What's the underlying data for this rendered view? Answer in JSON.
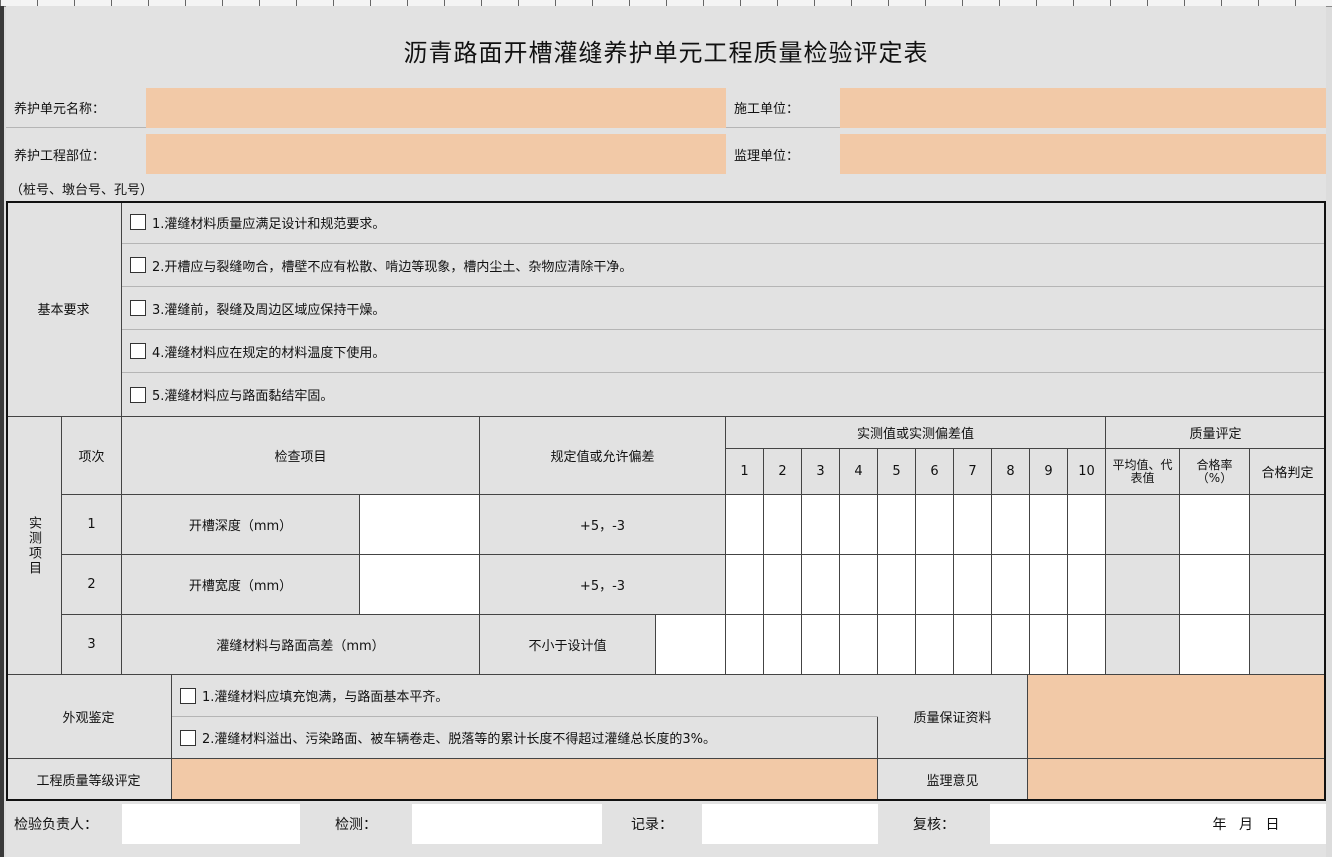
{
  "title": "沥青路面开槽灌缝养护单元工程质量检验评定表",
  "header": {
    "unit_name_label": "养护单元名称：",
    "unit_name_value": "",
    "contractor_label": "施工单位：",
    "contractor_value": "",
    "location_label": "养护工程部位：",
    "location_value": "",
    "supervisor_label": "监理单位：",
    "supervisor_value": "",
    "location_note": "（桩号、墩台号、孔号）"
  },
  "basic_requirements": {
    "label": "基本要求",
    "items": [
      "1.灌缝材料质量应满足设计和规范要求。",
      "2.开槽应与裂缝吻合，槽壁不应有松散、啃边等现象，槽内尘土、杂物应清除干净。",
      "3.灌缝前，裂缝及周边区域应保持干燥。",
      "4.灌缝材料应在规定的材料温度下使用。",
      "5.灌缝材料应与路面黏结牢固。"
    ]
  },
  "measured": {
    "section_label": "实测项目",
    "col_index": "项次",
    "col_item": "检查项目",
    "col_spec": "规定值或允许偏差",
    "col_values": "实测值或实测偏差值",
    "value_numbers": [
      "1",
      "2",
      "3",
      "4",
      "5",
      "6",
      "7",
      "8",
      "9",
      "10"
    ],
    "col_quality": "质量评定",
    "col_avg": "平均值、代表值",
    "col_rate": "合格率（%）",
    "col_judge": "合格判定",
    "rows": [
      {
        "index": "1",
        "item": "开槽深度（mm）",
        "spec": "+5，-3"
      },
      {
        "index": "2",
        "item": "开槽宽度（mm）",
        "spec": "+5，-3"
      },
      {
        "index": "3",
        "item": "灌缝材料与路面高差（mm）",
        "spec": "不小于设计值"
      }
    ]
  },
  "appearance": {
    "label": "外观鉴定",
    "items": [
      "1.灌缝材料应填充饱满，与路面基本平齐。",
      "2.灌缝材料溢出、污染路面、被车辆卷走、脱落等的累计长度不得超过灌缝总长度的3%。"
    ],
    "qa_label": "质量保证资料"
  },
  "grade": {
    "label": "工程质量等级评定",
    "opinion_label": "监理意见"
  },
  "footer": {
    "inspector": "检验负责人：",
    "testing": "检测：",
    "record": "记录：",
    "review": "复核：",
    "date": "年 月 日"
  },
  "colors": {
    "input_fill": "#f2c9a7",
    "sheet_bg": "#e2e2e2",
    "border": "#111111"
  }
}
